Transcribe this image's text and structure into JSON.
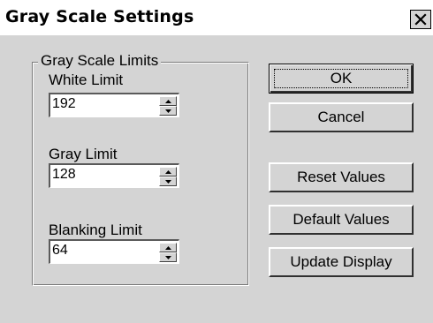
{
  "window": {
    "title": "Gray Scale Settings",
    "close_icon": "close-icon",
    "colors": {
      "face": "#d4d4d4",
      "title_bg": "#ffffff"
    }
  },
  "group": {
    "legend": "Gray Scale Limits",
    "fields": [
      {
        "label": "White Limit",
        "value": "192"
      },
      {
        "label": "Gray Limit",
        "value": "128"
      },
      {
        "label": "Blanking Limit",
        "value": "64"
      }
    ]
  },
  "buttons": {
    "ok": "OK",
    "cancel": "Cancel",
    "reset": "Reset Values",
    "default": "Default Values",
    "update": "Update Display"
  }
}
